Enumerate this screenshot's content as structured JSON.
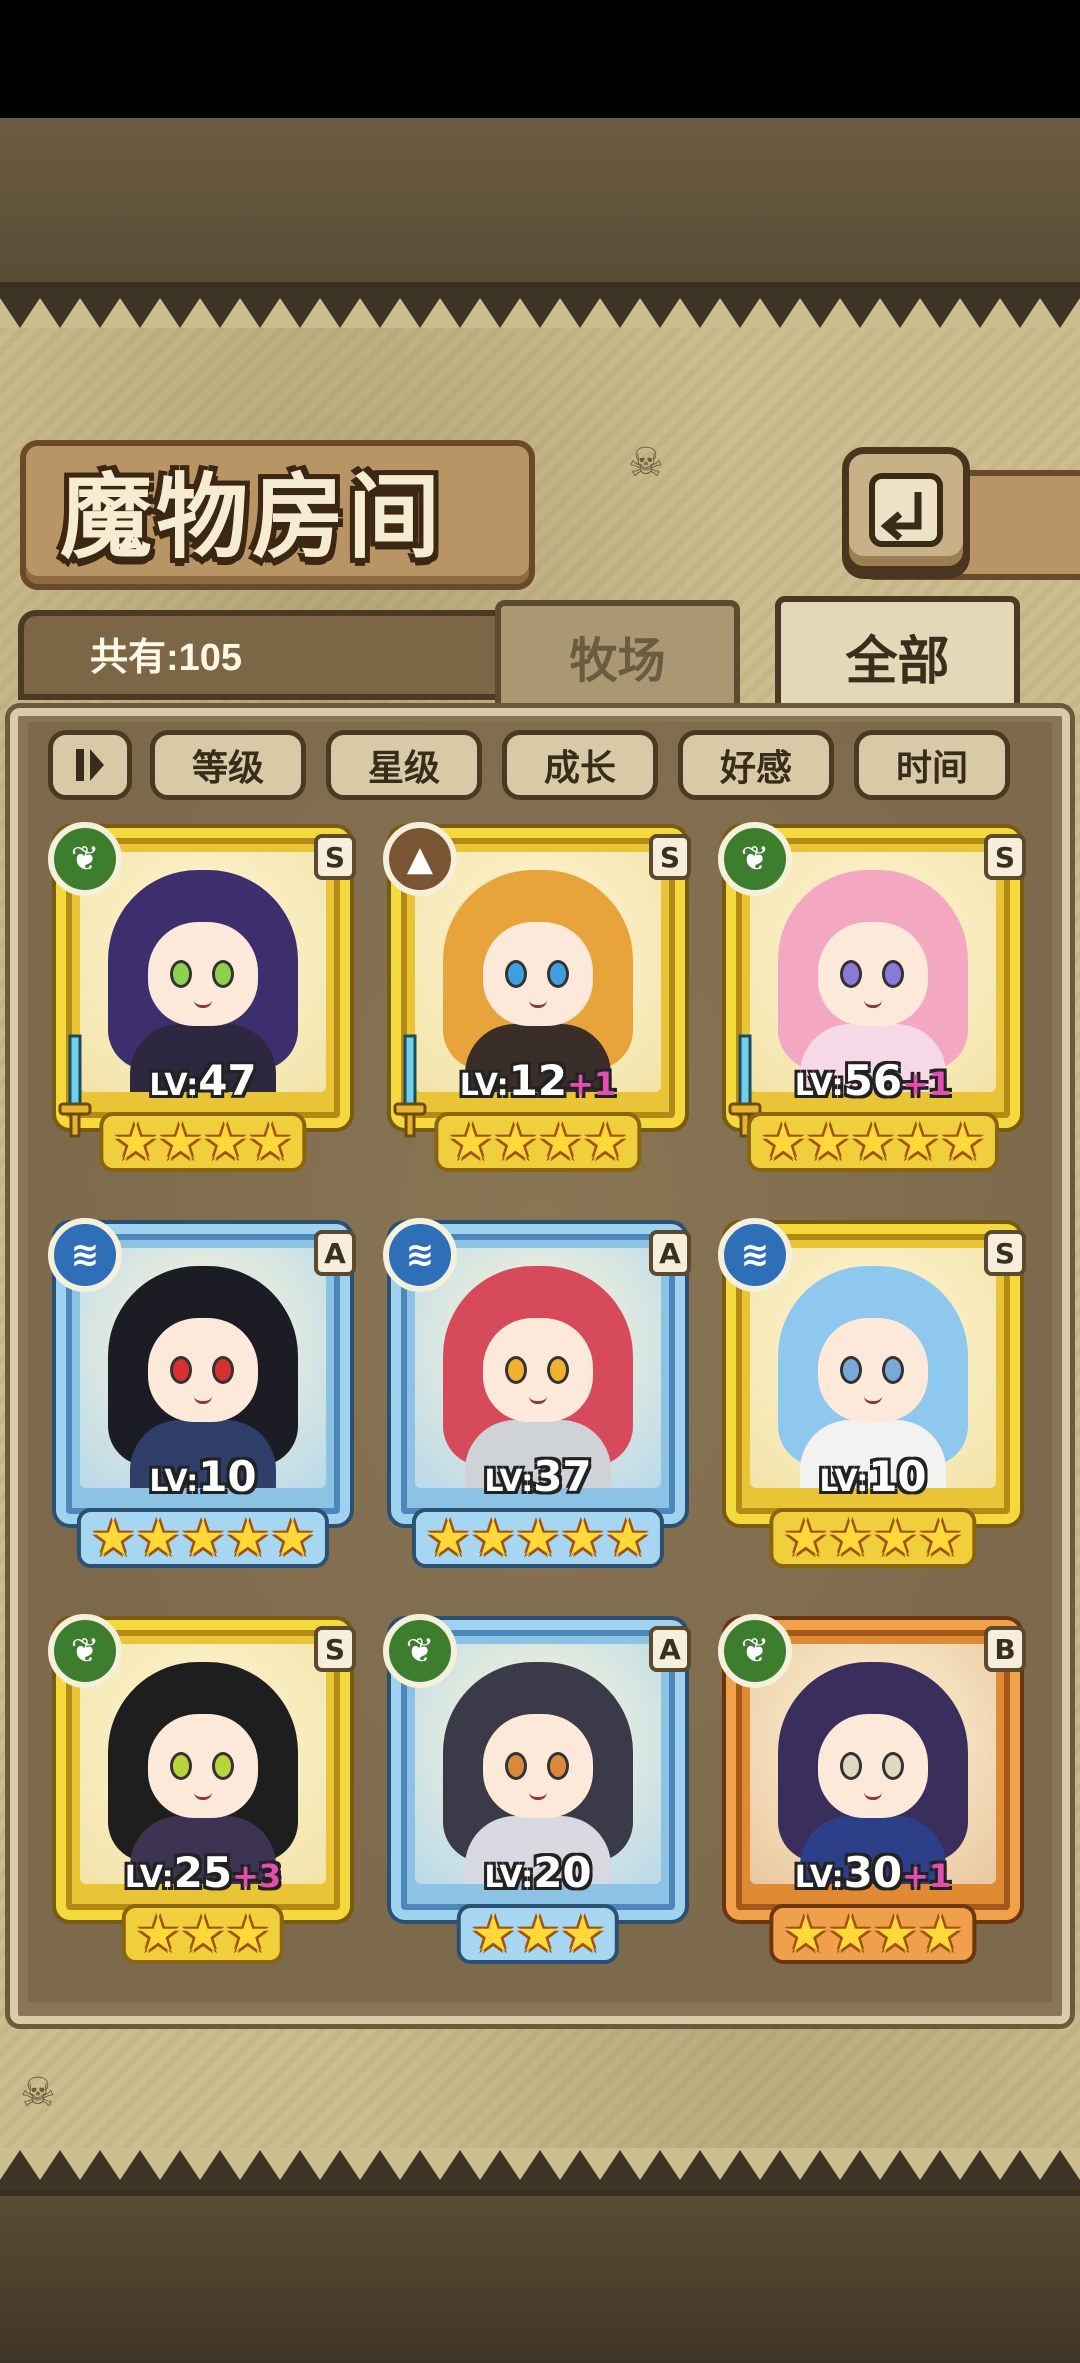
{
  "title": "魔物房间",
  "count_text": "共有:105",
  "tabs": {
    "pasture": "牧场",
    "all": "全部"
  },
  "sort_buttons": [
    "等级",
    "星级",
    "成长",
    "好感",
    "时间"
  ],
  "colors": {
    "gold_frame": "#f3d93b",
    "blue_frame": "#9fd2ee",
    "bronze_frame": "#f0a14a",
    "bonus_pink": "#e14fb0"
  },
  "monsters": [
    {
      "element": "leaf-icon",
      "rank": "S",
      "level_prefix": "LV:",
      "level": "47",
      "bonus": "",
      "stars": 4,
      "frame": "gold",
      "has_sword": true
    },
    {
      "element": "rock-icon",
      "rank": "S",
      "level_prefix": "LV:",
      "level": "12",
      "bonus": "+1",
      "stars": 4,
      "frame": "gold",
      "has_sword": true
    },
    {
      "element": "leaf-icon",
      "rank": "S",
      "level_prefix": "LV:",
      "level": "56",
      "bonus": "+1",
      "stars": 5,
      "frame": "gold",
      "has_sword": true
    },
    {
      "element": "water-icon",
      "rank": "A",
      "level_prefix": "LV:",
      "level": "10",
      "bonus": "",
      "stars": 5,
      "frame": "blue",
      "has_sword": false
    },
    {
      "element": "water-icon",
      "rank": "A",
      "level_prefix": "LV:",
      "level": "37",
      "bonus": "",
      "stars": 5,
      "frame": "blue",
      "has_sword": false
    },
    {
      "element": "water-icon",
      "rank": "S",
      "level_prefix": "LV:",
      "level": "10",
      "bonus": "",
      "stars": 4,
      "frame": "gold",
      "has_sword": false
    },
    {
      "element": "leaf-icon",
      "rank": "S",
      "level_prefix": "LV:",
      "level": "25",
      "bonus": "+3",
      "stars": 3,
      "frame": "gold",
      "has_sword": false
    },
    {
      "element": "leaf-icon",
      "rank": "A",
      "level_prefix": "LV:",
      "level": "20",
      "bonus": "",
      "stars": 3,
      "frame": "blue",
      "has_sword": false
    },
    {
      "element": "leaf-icon",
      "rank": "B",
      "level_prefix": "LV:",
      "level": "30",
      "bonus": "+1",
      "stars": 4,
      "frame": "bronze",
      "has_sword": false
    }
  ]
}
